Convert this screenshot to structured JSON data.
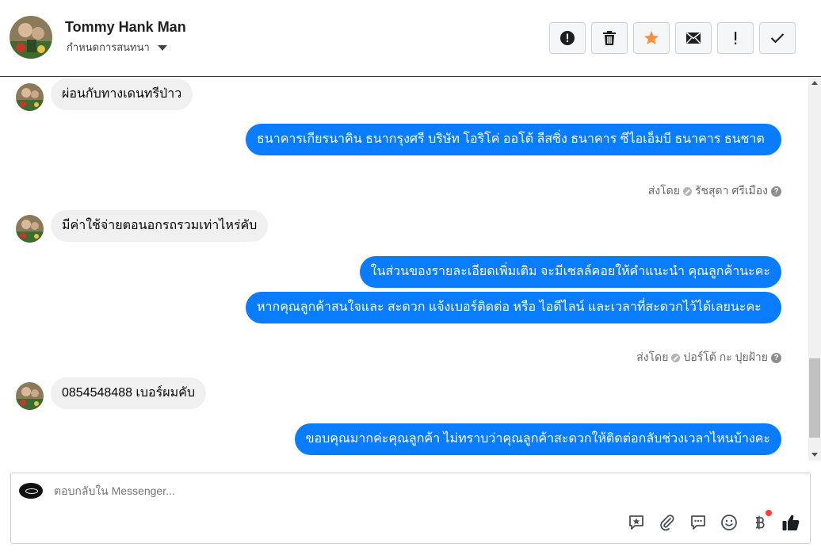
{
  "header": {
    "name": "Tommy Hank Man",
    "assign_label": "กำหนดการสนทนา",
    "toolbar": [
      {
        "icon": "alert-circle-icon",
        "name": "spam-button"
      },
      {
        "icon": "trash-icon",
        "name": "delete-button"
      },
      {
        "icon": "star-icon",
        "name": "star-button"
      },
      {
        "icon": "envelope-icon",
        "name": "mark-unread-button"
      },
      {
        "icon": "exclamation-icon",
        "name": "follow-up-button"
      },
      {
        "icon": "check-icon",
        "name": "done-button"
      }
    ]
  },
  "messages": [
    {
      "dir": "in",
      "text": "ผ่อนกับทางเดนทรีป่าว"
    },
    {
      "dir": "out",
      "text": "ธนาคารเกียรนาคิน  ธนากรุงศรี  บริษัท โอริโค่ ออโต้ ลีสซิ่ง ธนาคาร ซีไอเอ็มบี ธนาคาร ธนชาต"
    },
    {
      "dir": "meta",
      "prefix": "ส่งโดย",
      "sender": "รัชสุดา ศรีเมือง"
    },
    {
      "dir": "in",
      "text": "มีค่าใช้จ่ายตอนอกรถรวมเท่าไหร่คับ"
    },
    {
      "dir": "out",
      "text": "ในส่วนของรายละเอียดเพิ่มเติม จะมีเซลล์คอยให้คำแนะนำ คุณลูกค้านะคะ"
    },
    {
      "dir": "out",
      "text": "หากคุณลูกค้าสนใจและ สะดวก แจ้งเบอร์ติดต่อ หรือ ไอดีไลน์ และเวลาที่สะดวกไว้ได้เลยนะคะ"
    },
    {
      "dir": "meta",
      "prefix": "ส่งโดย",
      "sender": "ปอร์โต้ กะ ปุยฝ้าย"
    },
    {
      "dir": "in",
      "text": "0854548488 เบอร์ผมคับ"
    },
    {
      "dir": "out",
      "text": "ขอบคุณมากค่ะคุณลูกค้า ไม่ทราบว่าคุณลูกค้าสะดวกให้ติดต่อกลับช่วงเวลาไหนบ้างคะ"
    }
  ],
  "composer": {
    "placeholder": "ตอบกลับใน Messenger...",
    "icons": [
      "saved-reply-icon",
      "attachment-icon",
      "chat-bubble-icon",
      "emoji-icon",
      "baht-payment-icon",
      "thumbs-up-icon"
    ]
  },
  "colors": {
    "outgoing_bubble": "#0a7cff",
    "incoming_bubble": "#f0f0f0",
    "star": "#f7923b",
    "notification": "#fa3e3e"
  }
}
